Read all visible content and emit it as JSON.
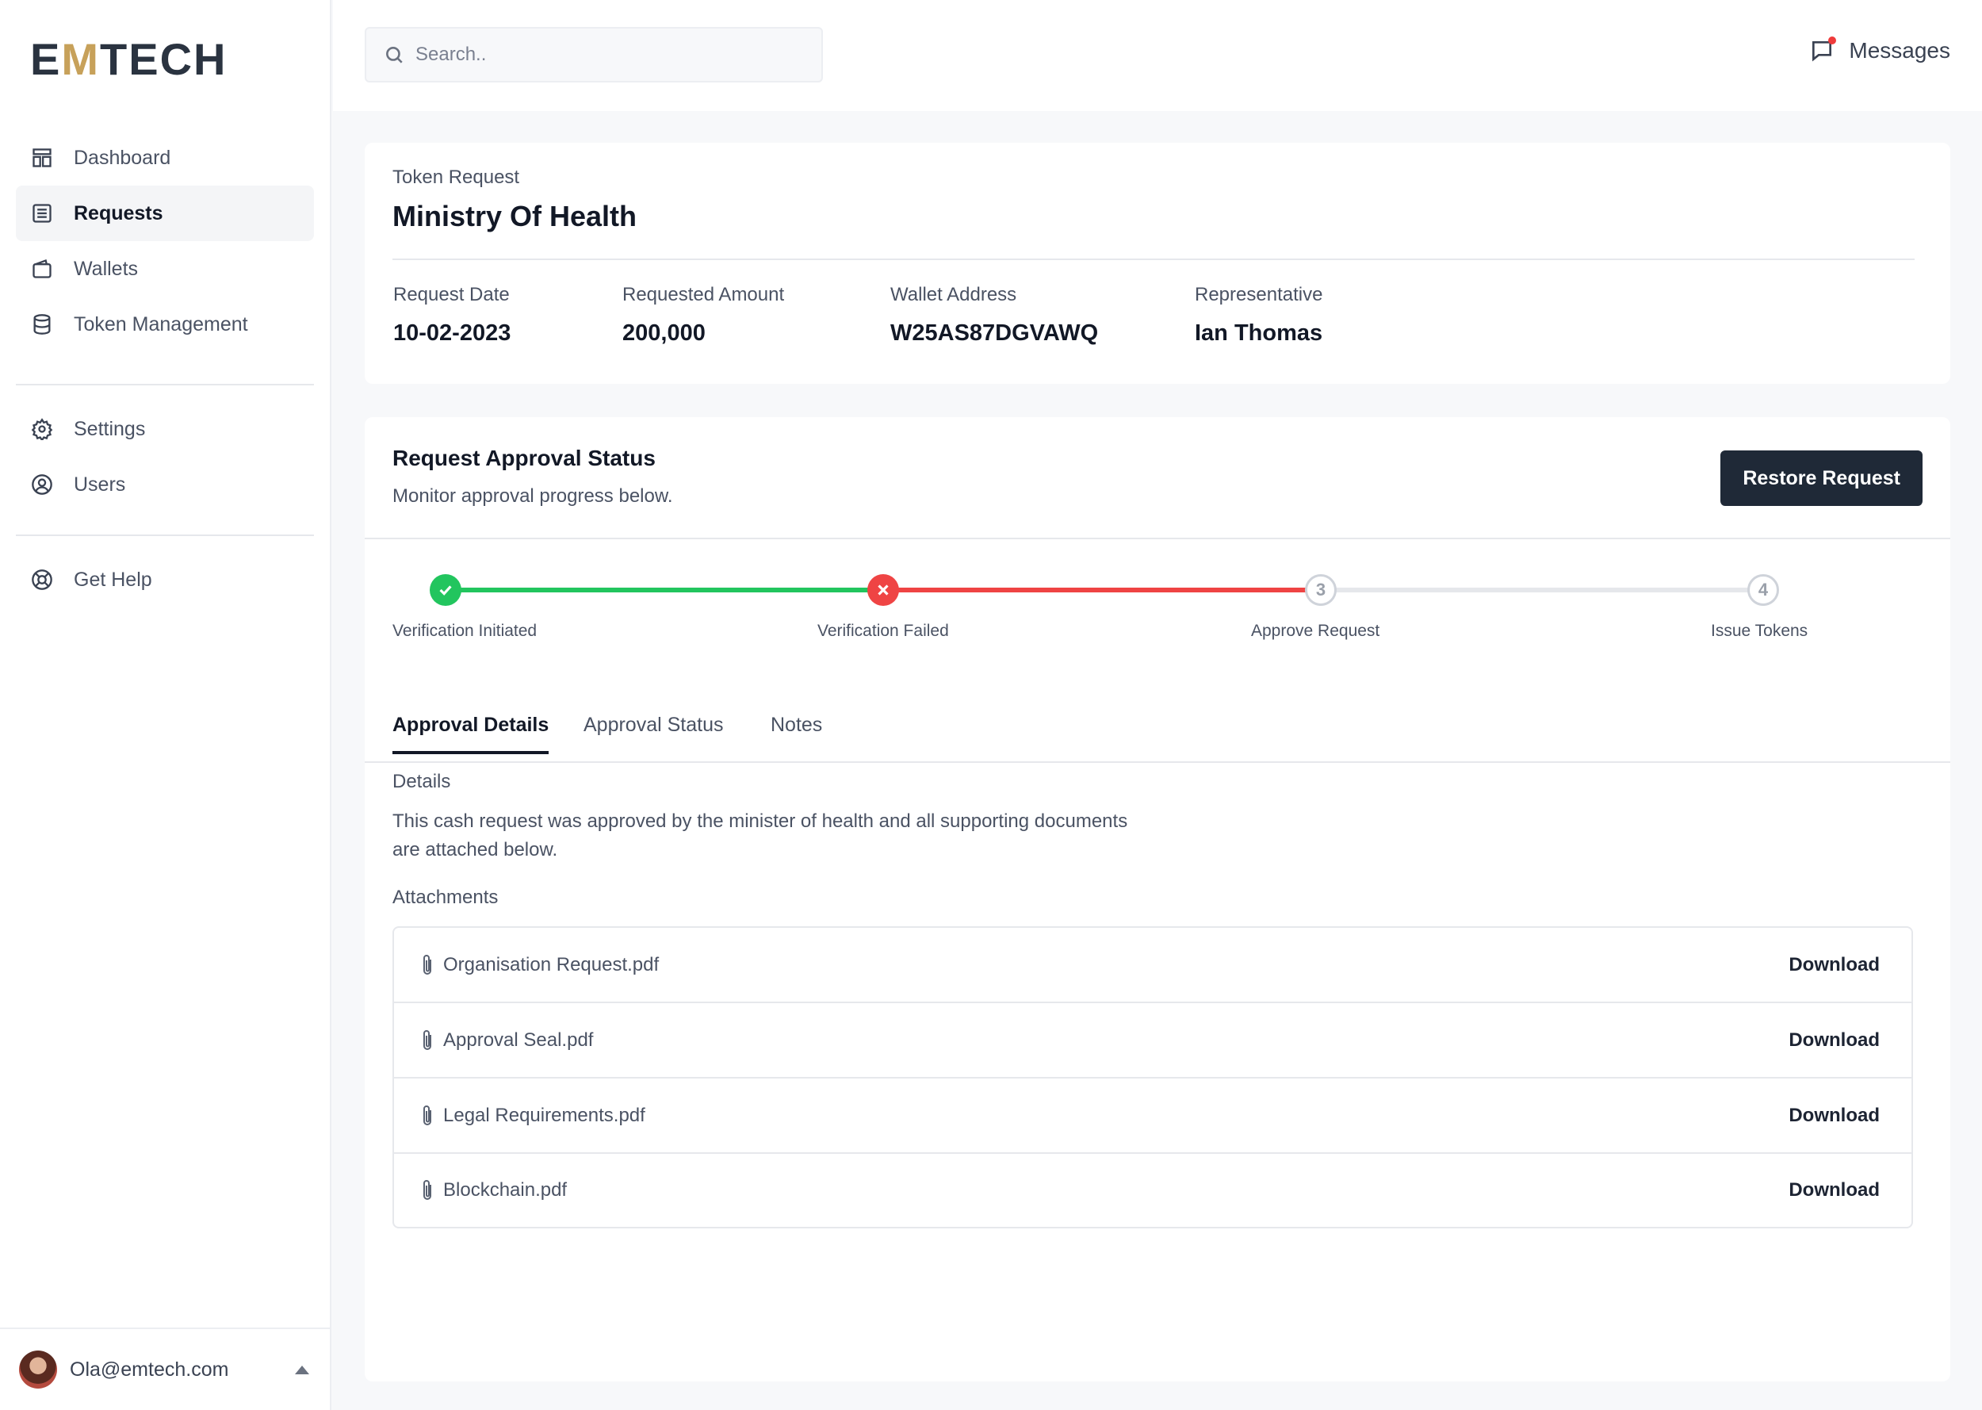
{
  "brand": {
    "logo_pre": "E",
    "logo_accent": "M",
    "logo_post": "TECH",
    "accent_color": "#c7a15a"
  },
  "sidebar": {
    "items": [
      {
        "label": "Dashboard",
        "icon": "dashboard-icon"
      },
      {
        "label": "Requests",
        "icon": "list-icon",
        "active": true
      },
      {
        "label": "Wallets",
        "icon": "wallet-icon"
      },
      {
        "label": "Token Management",
        "icon": "database-icon"
      },
      {
        "label": "Settings",
        "icon": "gear-icon"
      },
      {
        "label": "Users",
        "icon": "user-circle-icon"
      },
      {
        "label": "Get Help",
        "icon": "lifebuoy-icon"
      }
    ],
    "user_email": "Ola@emtech.com"
  },
  "topbar": {
    "search_placeholder": "Search..",
    "messages_label": "Messages"
  },
  "request": {
    "kicker": "Token Request",
    "title": "Ministry Of Health",
    "fields": [
      {
        "label": "Request Date",
        "value": "10-02-2023"
      },
      {
        "label": "Requested Amount",
        "value": "200,000"
      },
      {
        "label": "Wallet Address",
        "value": "W25AS87DGVAWQ"
      },
      {
        "label": "Representative",
        "value": "Ian Thomas"
      }
    ]
  },
  "approval": {
    "title": "Request Approval Status",
    "subtitle": "Monitor approval progress below.",
    "restore_label": "Restore Request",
    "steps": [
      {
        "label": "Verification Initiated",
        "state": "done",
        "marker": ""
      },
      {
        "label": "Verification Failed",
        "state": "failed",
        "marker": ""
      },
      {
        "label": "Approve Request",
        "state": "pending",
        "marker": "3"
      },
      {
        "label": "Issue Tokens",
        "state": "pending",
        "marker": "4"
      }
    ],
    "colors": {
      "done": "#22c55e",
      "failed": "#ef4444",
      "pending": "#e5e7eb"
    }
  },
  "tabs": [
    {
      "label": "Approval Details",
      "active": true
    },
    {
      "label": "Approval Status"
    },
    {
      "label": "Notes"
    }
  ],
  "details": {
    "heading": "Details",
    "body": "This cash request was approved by the minister of health and all supporting documents are attached below.",
    "attachments_heading": "Attachments",
    "attachments": [
      {
        "name": "Organisation Request.pdf",
        "action": "Download"
      },
      {
        "name": "Approval Seal.pdf",
        "action": "Download"
      },
      {
        "name": "Legal Requirements.pdf",
        "action": "Download"
      },
      {
        "name": "Blockchain.pdf",
        "action": "Download"
      }
    ]
  }
}
